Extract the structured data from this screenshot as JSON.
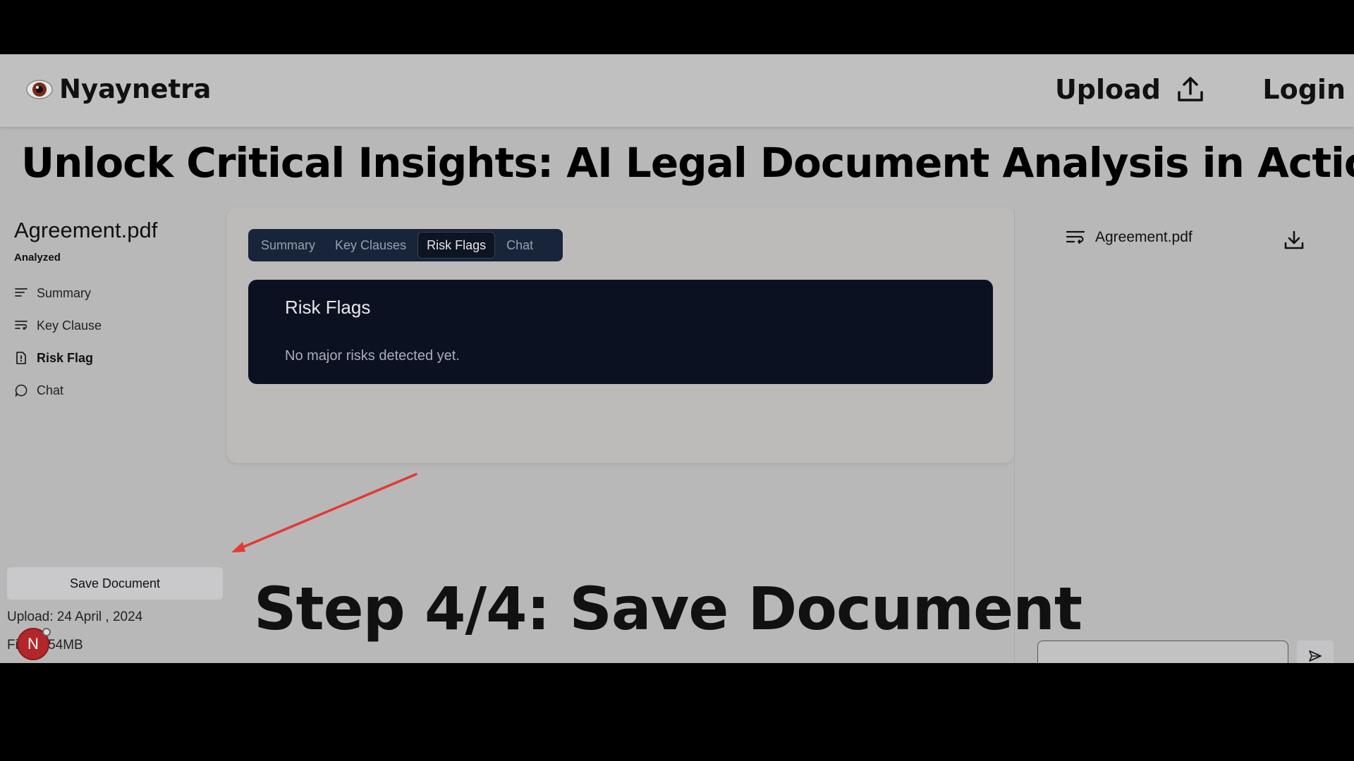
{
  "header": {
    "brand": "Nyaynetra",
    "upload_label": "Upload",
    "login_label": "Login"
  },
  "headline": "Unlock Critical Insights: AI Legal Document Analysis in Action",
  "sidebar": {
    "doc_title": "Agreement.pdf",
    "status": "Analyzed",
    "items": [
      {
        "label": "Summary",
        "icon": "summary-lines-icon"
      },
      {
        "label": "Key Clause",
        "icon": "key-clause-icon"
      },
      {
        "label": "Risk Flag",
        "icon": "risk-flag-icon"
      },
      {
        "label": "Chat",
        "icon": "chat-bubble-icon"
      }
    ],
    "save_button": "Save Document",
    "upload_date": "Upload: 24 April , 2024",
    "file_size": "Fi    e: 1.54MB",
    "avatar_letter": "N"
  },
  "main": {
    "tabs": [
      {
        "label": "Summary"
      },
      {
        "label": "Key Clauses"
      },
      {
        "label": "Risk Flags"
      },
      {
        "label": "Chat"
      }
    ],
    "active_tab": "Risk Flags",
    "panel_title": "Risk Flags",
    "panel_message": "No major risks detected yet."
  },
  "right_panel": {
    "doc_name": "Agreement.pdf"
  },
  "overlay": {
    "step_caption": "Step 4/4: Save Document",
    "arrow_color": "#e53935"
  },
  "colors": {
    "tabbar_bg": "#17243a",
    "panel_bg": "#0c1122",
    "avatar": "#b3262a"
  }
}
